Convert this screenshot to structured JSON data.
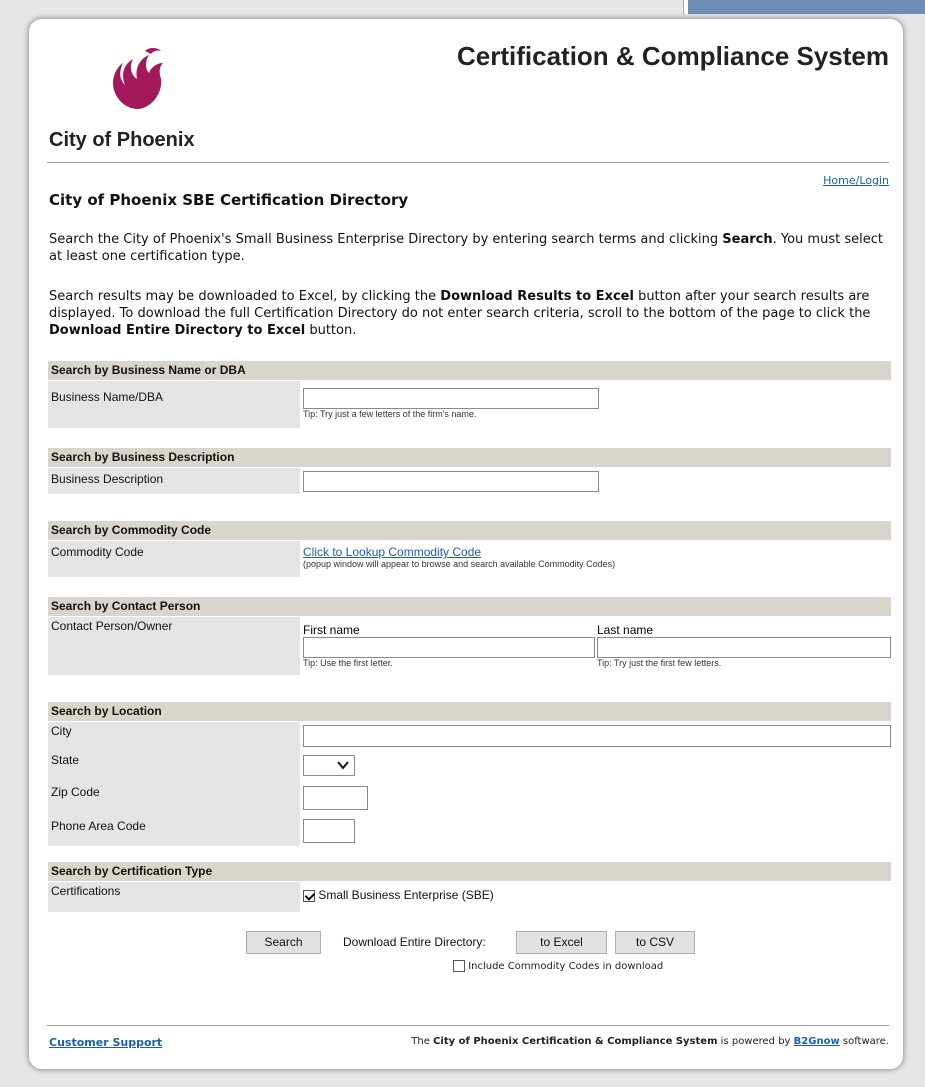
{
  "header": {
    "logo_text": "City of Phoenix",
    "system_title": "Certification & Compliance System",
    "home_link": "Home/Login"
  },
  "intro": {
    "title": "City of Phoenix SBE Certification Directory",
    "para1_a": "Search the City of Phoenix's Small Business Enterprise Directory by entering search terms and clicking ",
    "para1_b": "Search",
    "para1_c": ". You must select at least one certification type.",
    "para2_a": "Search results may be downloaded to Excel, by clicking the ",
    "para2_b": "Download Results to Excel",
    "para2_c": " button after your search results are displayed. To download the full Certification Directory do not enter search criteria, scroll to the bottom of the page to click the ",
    "para2_d": "Download Entire Directory to Excel",
    "para2_e": " button."
  },
  "business_name": {
    "header": "Search by Business Name or DBA",
    "label": "Business Name/DBA",
    "value": "",
    "tip": "Tip: Try just a few letters of the firm's name."
  },
  "business_desc": {
    "header": "Search by Business Description",
    "label": "Business Description",
    "value": ""
  },
  "commodity": {
    "header": "Search by Commodity Code",
    "label": "Commodity Code",
    "link": "Click to Lookup Commodity Code",
    "note": "(popup window will appear to browse and search available Commodity Codes)"
  },
  "contact": {
    "header": "Search by Contact Person",
    "label": "Contact Person/Owner",
    "first_label": "First name",
    "first_tip": "Tip: Use the first letter.",
    "last_label": "Last name",
    "last_tip": "Tip: Try just the first few letters."
  },
  "location": {
    "header": "Search by Location",
    "city_label": "City",
    "state_label": "State",
    "state_value": "",
    "zip_label": "Zip Code",
    "phone_label": "Phone Area Code"
  },
  "certification": {
    "header": "Search by Certification Type",
    "label": "Certifications",
    "option": "Small Business Enterprise (SBE)",
    "checked": true
  },
  "actions": {
    "search": "Search",
    "download_label": "Download Entire Directory:",
    "to_excel": "to Excel",
    "to_csv": "to CSV",
    "include_codes": "Include Commodity Codes in download"
  },
  "footer": {
    "support": "Customer Support",
    "powered_a": "The ",
    "powered_b": "City of Phoenix Certification & Compliance System",
    "powered_c": " is powered by ",
    "powered_d": "B2Gnow",
    "powered_e": " software."
  },
  "colors": {
    "logo_magenta": "#a3195b",
    "link_blue": "#1a5fb4",
    "section_header": "#d9d4cc",
    "label_bg": "#e4e4e4"
  }
}
